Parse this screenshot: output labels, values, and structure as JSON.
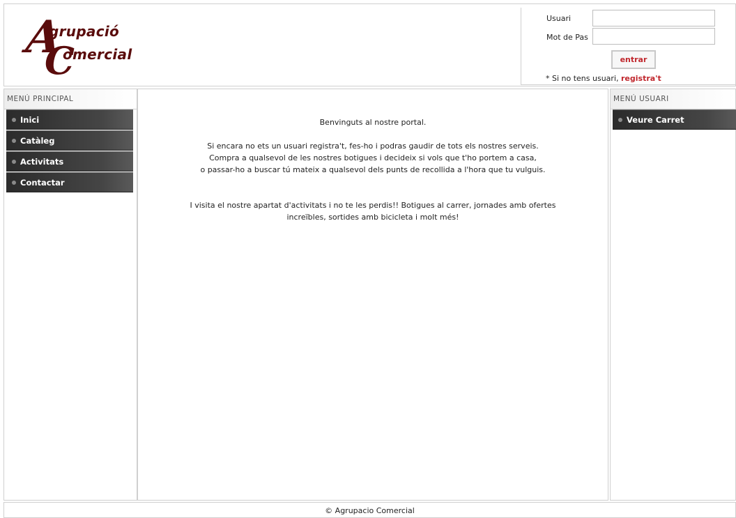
{
  "header": {
    "logo": {
      "big_a": "A",
      "word1": "grupació",
      "big_c": "C",
      "word2": "omercial",
      "color": "#5a0c0c"
    },
    "login": {
      "user_label": "Usuari",
      "password_label": "Mot de Pas",
      "user_value": "",
      "password_value": "",
      "submit_label": "entrar",
      "register_prefix": "* Si no tens usuari, ",
      "register_link": "registra't"
    }
  },
  "left_menu": {
    "title": "MENÚ PRINCIPAL",
    "items": [
      {
        "label": "Inici"
      },
      {
        "label": "Catàleg"
      },
      {
        "label": "Activitats"
      },
      {
        "label": "Contactar"
      }
    ]
  },
  "right_menu": {
    "title": "MENÚ USUARI",
    "items": [
      {
        "label": "Veure Carret"
      }
    ]
  },
  "main": {
    "welcome": "Benvinguts al nostre portal.",
    "para1_line1": "Si encara no ets un usuari registra't, fes-ho i podras gaudir de tots els nostres serveis.",
    "para1_line2": "Compra a qualsevol de les nostres botigues i decideix si vols que t'ho portem a casa,",
    "para1_line3": "o passar-ho a buscar tú mateix a qualsevol dels punts de recollida a l'hora que tu vulguis.",
    "para2_line1": "I visita el nostre apartat d'activitats i no te les perdis!! Botigues al carrer, jornades amb ofertes",
    "para2_line2": "increïbles, sortides amb bicicleta i molt més!"
  },
  "footer": {
    "text": "© Agrupacio Comercial"
  },
  "colors": {
    "accent_red": "#c0272d",
    "menu_dark": "#2b2b2b",
    "border": "#cfcfcf"
  }
}
